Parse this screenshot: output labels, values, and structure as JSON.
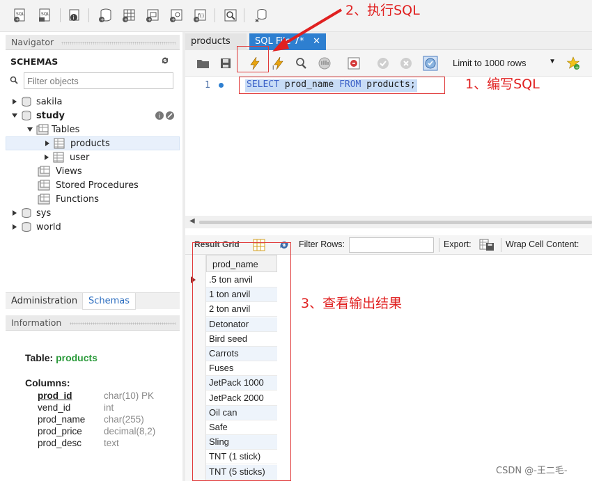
{
  "colors": {
    "accent": "#2e7fd0",
    "annotation": "#e02020",
    "table_name": "#2a9a3a",
    "selection": "#c8dcf6"
  },
  "toolbar": {
    "icons": [
      "new-sql-tab-icon",
      "open-sql-script-icon",
      "open-inspector-icon",
      "create-schema-icon",
      "create-table-icon",
      "create-view-icon",
      "create-procedure-icon",
      "create-function-icon",
      "search-table-data-icon",
      "reconnect-icon"
    ]
  },
  "navigator": {
    "title": "Navigator",
    "schemas_label": "SCHEMAS",
    "filter_placeholder": "Filter objects",
    "tree": {
      "sakila": "sakila",
      "study": "study",
      "tables": "Tables",
      "products": "products",
      "user": "user",
      "views": "Views",
      "stored_procedures": "Stored Procedures",
      "functions": "Functions",
      "sys": "sys",
      "world": "world"
    }
  },
  "bottom_tabs": {
    "administration": "Administration",
    "schemas": "Schemas"
  },
  "information": {
    "title": "Information",
    "table_label": "Table: ",
    "table_name": "products",
    "columns_label": "Columns:",
    "columns": [
      {
        "name": "prod_id",
        "type": "char(10) PK"
      },
      {
        "name": "vend_id",
        "type": "int"
      },
      {
        "name": "prod_name",
        "type": "char(255)"
      },
      {
        "name": "prod_price",
        "type": "decimal(8,2)"
      },
      {
        "name": "prod_desc",
        "type": "text"
      }
    ]
  },
  "editor_tabs": {
    "products": "products",
    "sql_file": "SQL File 7*"
  },
  "editor_toolbar": {
    "limit_label": "Limit to 1000 rows"
  },
  "editor": {
    "line_number": "1",
    "sql": {
      "kw_select": "SELECT",
      "col": " prod_name ",
      "kw_from": "FROM",
      "table": " products;"
    }
  },
  "result": {
    "tab": "Result Grid",
    "filter_rows_label": "Filter Rows:",
    "export_label": "Export:",
    "wrap_label": "Wrap Cell Content:",
    "column_header": "prod_name",
    "rows": [
      ".5 ton anvil",
      "1 ton anvil",
      "2 ton anvil",
      "Detonator",
      "Bird seed",
      "Carrots",
      "Fuses",
      "JetPack 1000",
      "JetPack 2000",
      "Oil can",
      "Safe",
      "Sling",
      "TNT (1 stick)",
      "TNT (5 sticks)"
    ]
  },
  "annotations": {
    "execute": "2、执行SQL",
    "write": "1、编写SQL",
    "view": "3、查看输出结果"
  },
  "watermark": "CSDN @-王二毛-"
}
